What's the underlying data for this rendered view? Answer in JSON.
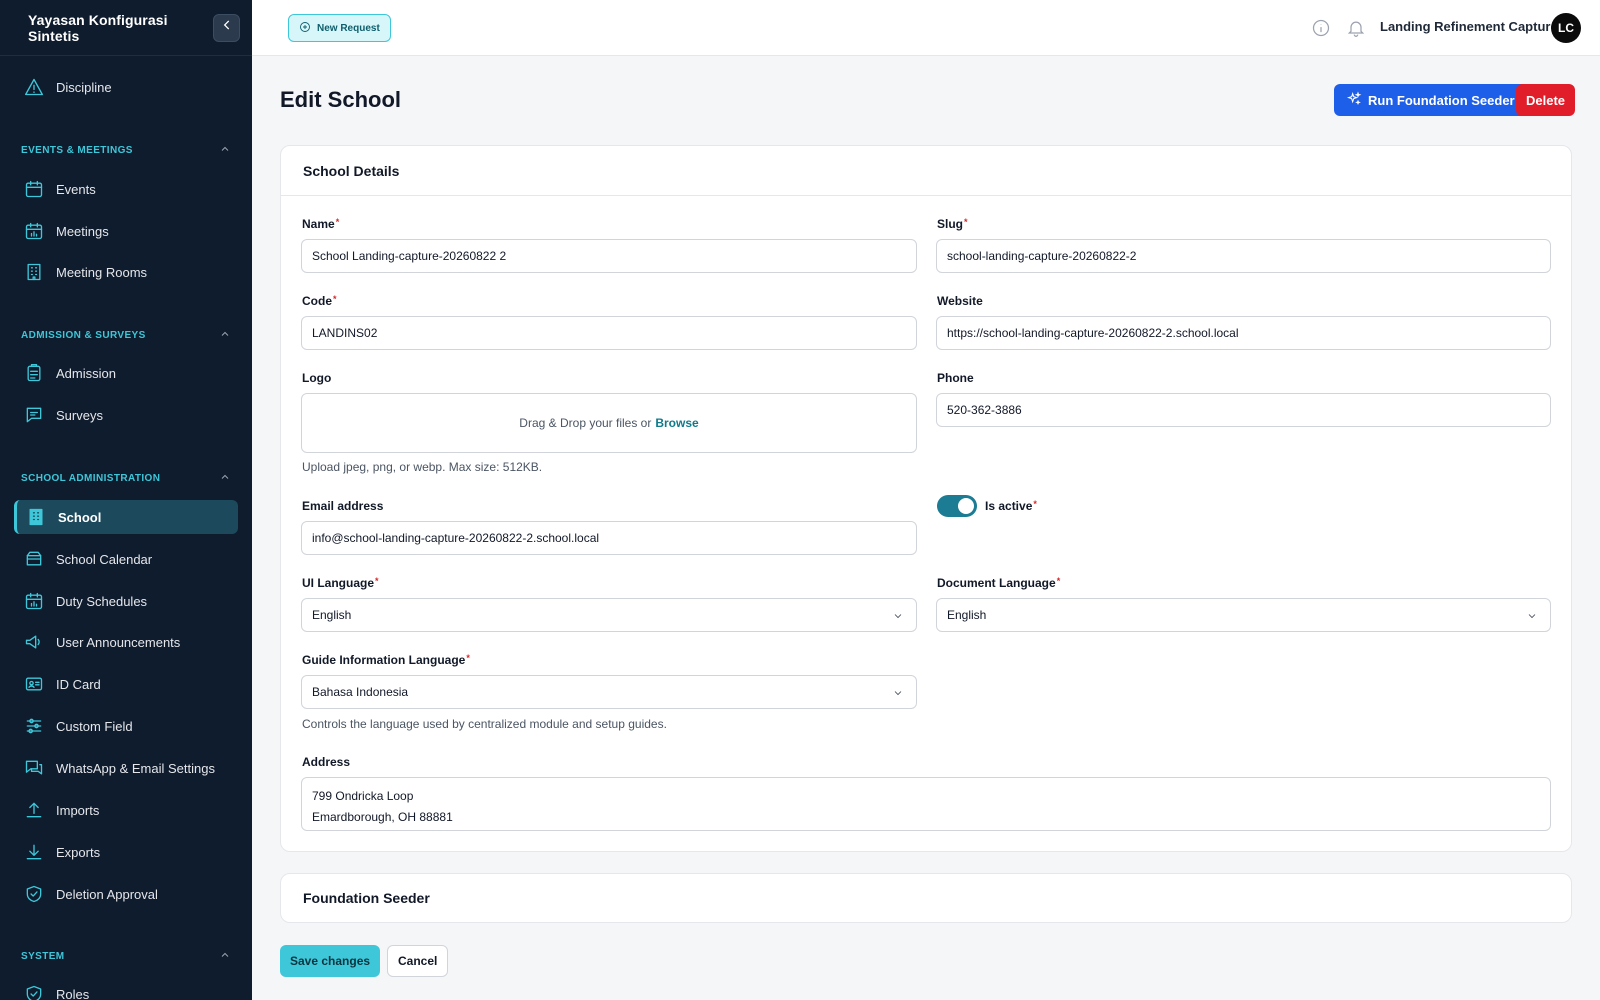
{
  "sidebar": {
    "brand": "Yayasan Konfigurasi Sintetis",
    "items_top": [
      {
        "label": "Discipline",
        "icon": "warning-triangle-icon"
      }
    ],
    "groups": [
      {
        "label": "EVENTS & MEETINGS"
      },
      {
        "label": "ADMISSION & SURVEYS"
      },
      {
        "label": "SCHOOL ADMINISTRATION"
      },
      {
        "label": "SYSTEM"
      }
    ],
    "events": [
      {
        "label": "Events",
        "icon": "calendar-icon"
      },
      {
        "label": "Meetings",
        "icon": "calendar-chart-icon"
      },
      {
        "label": "Meeting Rooms",
        "icon": "building-icon"
      }
    ],
    "admission": [
      {
        "label": "Admission",
        "icon": "clipboard-icon"
      },
      {
        "label": "Surveys",
        "icon": "chat-icon"
      }
    ],
    "school": [
      {
        "label": "School",
        "icon": "building-icon",
        "active": true
      },
      {
        "label": "School Calendar",
        "icon": "inbox-icon"
      },
      {
        "label": "Duty Schedules",
        "icon": "calendar-chart-icon"
      },
      {
        "label": "User Announcements",
        "icon": "megaphone-icon"
      },
      {
        "label": "ID Card",
        "icon": "id-card-icon"
      },
      {
        "label": "Custom Field",
        "icon": "sliders-icon"
      },
      {
        "label": "WhatsApp & Email Settings",
        "icon": "chat-bubbles-icon"
      },
      {
        "label": "Imports",
        "icon": "upload-icon"
      },
      {
        "label": "Exports",
        "icon": "download-icon"
      },
      {
        "label": "Deletion Approval",
        "icon": "shield-check-icon"
      }
    ],
    "system": [
      {
        "label": "Roles",
        "icon": "shield-check-icon"
      }
    ]
  },
  "topbar": {
    "new_request": "New Request",
    "user_name": "Landing Refinement Capture",
    "avatar_initials": "LC"
  },
  "page": {
    "title": "Edit School",
    "run_seeder": "Run Foundation Seeder",
    "delete": "Delete"
  },
  "form": {
    "section_title": "School Details",
    "name": {
      "label": "Name",
      "value": "School Landing-capture-20260822 2"
    },
    "slug": {
      "label": "Slug",
      "value": "school-landing-capture-20260822-2"
    },
    "code": {
      "label": "Code",
      "value": "LANDINS02"
    },
    "website": {
      "label": "Website",
      "value": "https://school-landing-capture-20260822-2.school.local"
    },
    "logo": {
      "label": "Logo",
      "drop_text": "Drag & Drop your files or",
      "browse": "Browse",
      "help": "Upload jpeg, png, or webp. Max size: 512KB."
    },
    "phone": {
      "label": "Phone",
      "value": "520-362-3886"
    },
    "email": {
      "label": "Email address",
      "value": "info@school-landing-capture-20260822-2.school.local"
    },
    "is_active": {
      "label": "Is active",
      "value": true
    },
    "ui_language": {
      "label": "UI Language",
      "value": "English"
    },
    "document_language": {
      "label": "Document Language",
      "value": "English"
    },
    "guide_language": {
      "label": "Guide Information Language",
      "value": "Bahasa Indonesia",
      "help": "Controls the language used by centralized module and setup guides."
    },
    "address": {
      "label": "Address",
      "line1": "799 Ondricka Loop",
      "line2": "Emardborough, OH 88881"
    },
    "required_mark": "*"
  },
  "seeder_section": {
    "title": "Foundation Seeder"
  },
  "actions": {
    "save": "Save changes",
    "cancel": "Cancel"
  },
  "colors": {
    "sidebar_bg": "#0f1c2e",
    "accent": "#3ec7d8",
    "primary": "#1d5fe8",
    "danger": "#e11d2a"
  }
}
